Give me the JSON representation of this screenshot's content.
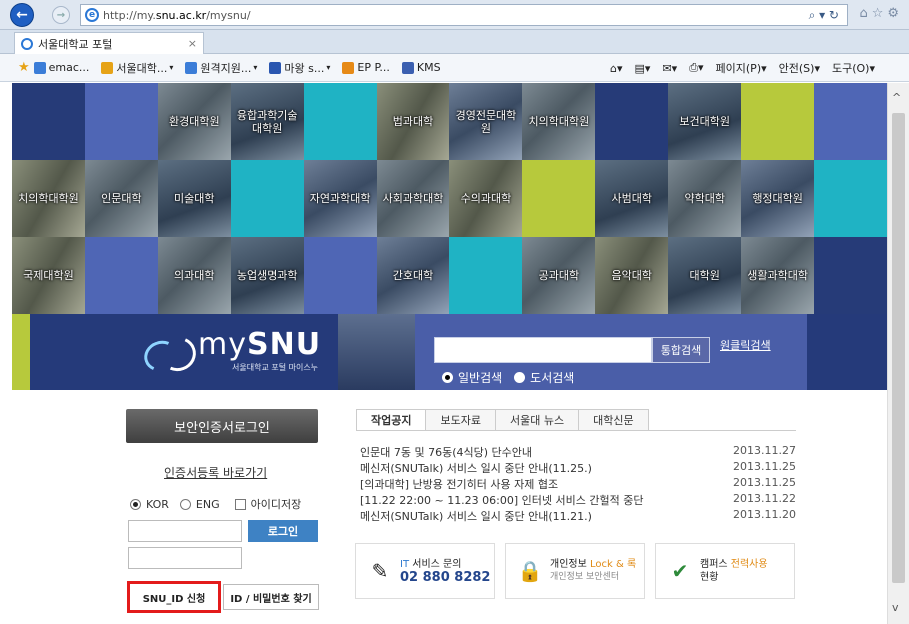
{
  "browser": {
    "url_prefix": "http://my.",
    "url_domain": "snu.ac.kr",
    "url_path": "/mysnu/",
    "address_tools": "⌕ ▾ ↻",
    "right_icons": "⌂☆⚙",
    "tab_title": "서울대학교 포털",
    "tab_close": "×",
    "favorites": [
      {
        "label": "emac...",
        "icon_color": "#3b7dd8"
      },
      {
        "label": "서울대학...",
        "icon_color": "#e6a317"
      },
      {
        "label": "원격지원...",
        "icon_color": "#3b7dd8"
      },
      {
        "label": "마왕 s...",
        "icon_color": "#2a56b0"
      },
      {
        "label": "EP P...",
        "icon_color": "#e68a17"
      },
      {
        "label": "KMS",
        "icon_color": "#3b5fb0"
      }
    ],
    "commands": [
      "페이지(P)",
      "안전(S)",
      "도구(O)"
    ],
    "chevron": "▾"
  },
  "tiles": [
    {
      "label": "",
      "style": "t-navy"
    },
    {
      "label": "",
      "style": "t-blue"
    },
    {
      "label": "환경대학원",
      "style": "t-photo"
    },
    {
      "label": "융합과학기술\n대학원",
      "style": "t-photo2"
    },
    {
      "label": "",
      "style": "t-teal"
    },
    {
      "label": "법과대학",
      "style": "t-photo3"
    },
    {
      "label": "경영전문대학원",
      "style": "t-photo4"
    },
    {
      "label": "치의학대학원",
      "style": "t-photo"
    },
    {
      "label": "",
      "style": "t-navy"
    },
    {
      "label": "보건대학원",
      "style": "t-photo2"
    },
    {
      "label": "",
      "style": "t-lime"
    },
    {
      "label": "",
      "style": "t-blue"
    },
    {
      "label": "치의학대학원",
      "style": "t-photo3"
    },
    {
      "label": "인문대학",
      "style": "t-photo"
    },
    {
      "label": "미술대학",
      "style": "t-photo2"
    },
    {
      "label": "",
      "style": "t-teal"
    },
    {
      "label": "자연과학대학",
      "style": "t-photo4"
    },
    {
      "label": "사회과학대학",
      "style": "t-photo"
    },
    {
      "label": "수의과대학",
      "style": "t-photo3"
    },
    {
      "label": "",
      "style": "t-lime"
    },
    {
      "label": "사범대학",
      "style": "t-photo2"
    },
    {
      "label": "약학대학",
      "style": "t-photo"
    },
    {
      "label": "행정대학원",
      "style": "t-photo4"
    },
    {
      "label": "",
      "style": "t-teal"
    },
    {
      "label": "국제대학원",
      "style": "t-photo3"
    },
    {
      "label": "",
      "style": "t-blue"
    },
    {
      "label": "의과대학",
      "style": "t-photo"
    },
    {
      "label": "농업생명과학",
      "style": "t-photo2"
    },
    {
      "label": "",
      "style": "t-blue"
    },
    {
      "label": "간호대학",
      "style": "t-photo4"
    },
    {
      "label": "",
      "style": "t-teal"
    },
    {
      "label": "공과대학",
      "style": "t-photo"
    },
    {
      "label": "음악대학",
      "style": "t-photo3"
    },
    {
      "label": "대학원",
      "style": "t-photo2"
    },
    {
      "label": "생활과학대학",
      "style": "t-photo"
    },
    {
      "label": "",
      "style": "t-navy"
    }
  ],
  "portal": {
    "logo_my": "my",
    "logo_snu": "SNU",
    "logo_sub": "서울대학교 포털 마이스누",
    "search_button": "통합검색",
    "onclick_search": "원클릭검색",
    "search_scope": [
      {
        "label": "일반검색",
        "selected": true
      },
      {
        "label": "도서검색",
        "selected": false
      }
    ]
  },
  "login": {
    "cert_login": "보안인증서로그인",
    "cert_register": "인증서등록 바로가기",
    "lang_kor": "KOR",
    "lang_eng": "ENG",
    "save_id": "아이디저장",
    "login_button": "로그인",
    "snu_id_button": "SNU_ID 신청",
    "find_button": "ID / 비밀번호 찾기"
  },
  "news": {
    "tabs": [
      "작업공지",
      "보도자료",
      "서울대 뉴스",
      "대학신문"
    ],
    "items": [
      {
        "title": "인문대 7동 및 76동(4식당) 단수안내",
        "date": "2013.11.27"
      },
      {
        "title": "메신저(SNUTalk) 서비스 일시 중단 안내(11.25.)",
        "date": "2013.11.25"
      },
      {
        "title": "[의과대학] 난방용 전기히터 사용 자제 협조",
        "date": "2013.11.25"
      },
      {
        "title": "[11.22 22:00 ~ 11.23 06:00] 인터넷 서비스 간헐적 중단",
        "date": "2013.11.22"
      },
      {
        "title": "메신저(SNUTalk) 서비스 일시 중단 안내(11.21.)",
        "date": "2013.11.20"
      }
    ]
  },
  "banners": {
    "it_line1_a": "IT ",
    "it_line1_b": "서비스 문의",
    "it_phone": "02 880 8282",
    "privacy_a": "개인정보 ",
    "privacy_b": "Lock & 록",
    "privacy_sub": "개인정보 보안센터",
    "campus_a": "캠퍼스 ",
    "campus_b": "전력사용",
    "campus_c": "현황"
  }
}
